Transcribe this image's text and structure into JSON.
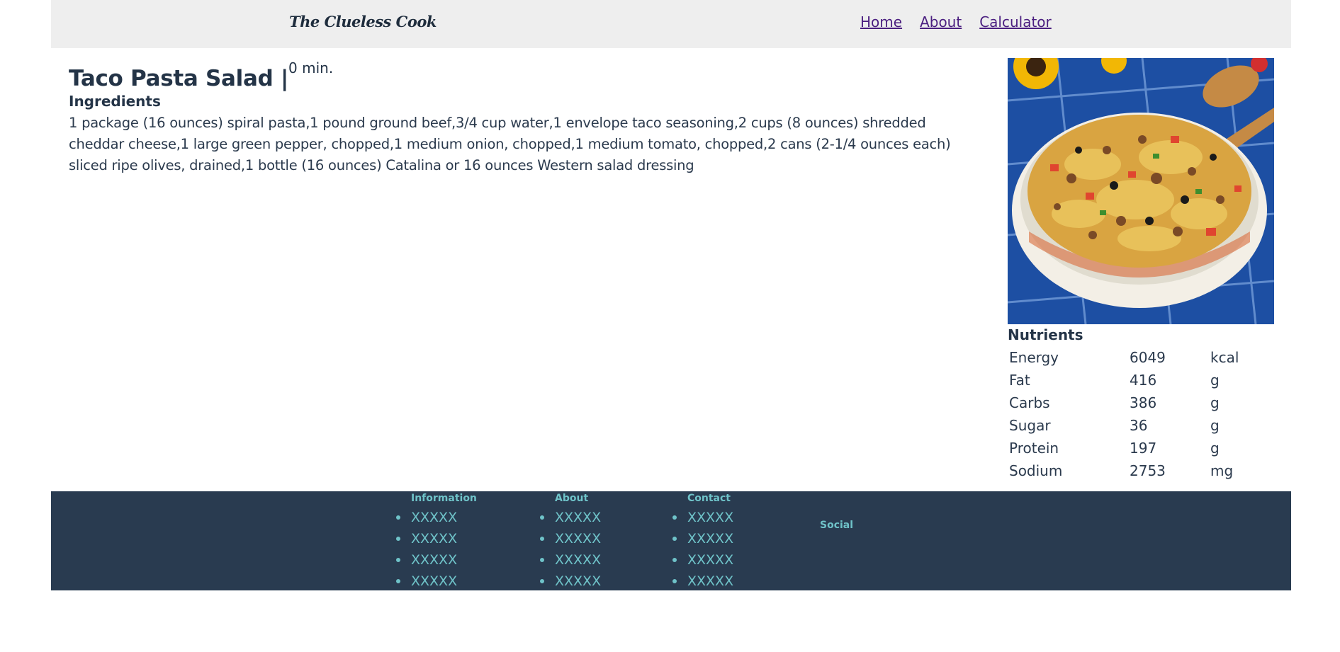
{
  "header": {
    "brand": "The Clueless Cook",
    "nav": [
      "Home",
      "About",
      "Calculator"
    ]
  },
  "recipe": {
    "title": "Taco Pasta Salad |",
    "time": "0 min.",
    "ingredients_heading": "Ingredients",
    "ingredients": "1 package (16 ounces) spiral pasta,1 pound ground beef,3/4 cup water,1 envelope taco seasoning,2 cups (8 ounces) shredded cheddar cheese,1 large green pepper, chopped,1 medium onion, chopped,1 medium tomato, chopped,2 cans (2-1/4 ounces each) sliced ripe olives, drained,1 bottle (16 ounces) Catalina or 16 ounces Western salad dressing"
  },
  "nutrients": {
    "heading": "Nutrients",
    "rows": [
      {
        "name": "Energy",
        "value": "6049",
        "unit": "kcal"
      },
      {
        "name": "Fat",
        "value": "416",
        "unit": "g"
      },
      {
        "name": "Carbs",
        "value": "386",
        "unit": "g"
      },
      {
        "name": "Sugar",
        "value": "36",
        "unit": "g"
      },
      {
        "name": "Protein",
        "value": "197",
        "unit": "g"
      },
      {
        "name": "Sodium",
        "value": "2753",
        "unit": "mg"
      }
    ]
  },
  "footer": {
    "columns": [
      {
        "heading": "Information",
        "items": [
          "XXXXX",
          "XXXXX",
          "XXXXX",
          "XXXXX"
        ]
      },
      {
        "heading": "About",
        "items": [
          "XXXXX",
          "XXXXX",
          "XXXXX",
          "XXXXX"
        ]
      },
      {
        "heading": "Contact",
        "items": [
          "XXXXX",
          "XXXXX",
          "XXXXX",
          "XXXXX"
        ]
      }
    ],
    "social": "Social"
  },
  "colors": {
    "header_bg": "#eeeeee",
    "footer_bg": "#293b50",
    "footer_text": "#6fc3c9",
    "link": "#4b1f80",
    "text": "#2b3a4d"
  }
}
